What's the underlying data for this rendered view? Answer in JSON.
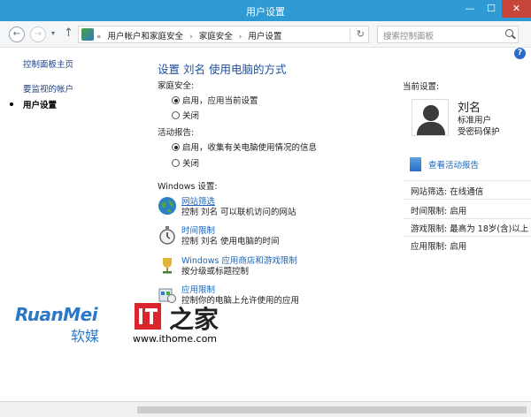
{
  "window": {
    "title": "用户设置",
    "min_symbol": "—",
    "max_symbol": "☐",
    "close_symbol": "✕"
  },
  "nav": {
    "back_symbol": "←",
    "forward_symbol": "→",
    "recent_symbol": "▾",
    "up_symbol": "↑",
    "breadcrumb_prefix": "«",
    "breadcrumbs": [
      "用户帐户和家庭安全",
      "家庭安全",
      "用户设置"
    ],
    "separator": "›",
    "dropdown_symbol": "▾",
    "refresh_symbol": "↻",
    "search_placeholder": "搜索控制面板"
  },
  "help_symbol": "?",
  "sidebar": {
    "home": "控制面板主页",
    "items": [
      "要监视的帐户",
      "用户设置"
    ]
  },
  "main": {
    "title": "设置 刘名 使用电脑的方式",
    "family_safety": {
      "label": "家庭安全:",
      "options": [
        "启用，应用当前设置",
        "关闭"
      ],
      "selected": 0
    },
    "activity": {
      "label": "活动报告:",
      "options": [
        "启用，收集有关电脑使用情况的信息",
        "关闭"
      ],
      "selected": 0
    },
    "windows_settings_label": "Windows 设置:",
    "settings": [
      {
        "name": "网站筛选",
        "desc": "控制 刘名 可以联机访问的网站",
        "icon": "globe-icon"
      },
      {
        "name": "时间限制",
        "desc": "控制 刘名 使用电脑的时间",
        "icon": "stopwatch-icon"
      },
      {
        "name": "Windows 应用商店和游戏限制",
        "desc": "按分级或标题控制",
        "icon": "trophy-icon"
      },
      {
        "name": "应用限制",
        "desc": "控制你的电脑上允许使用的应用",
        "icon": "app-restriction-icon"
      }
    ]
  },
  "panel": {
    "current_settings": "当前设置:",
    "user_name": "刘名",
    "user_type": "标准用户",
    "user_password": "受密码保护",
    "report_link": "查看活动报告",
    "details": [
      {
        "label": "网站筛选",
        "value": "在线通信"
      },
      {
        "label": "时间限制",
        "value": "启用"
      },
      {
        "label": "游戏限制",
        "value": "最高为 18岁(含)以上"
      },
      {
        "label": "应用限制",
        "value": "启用"
      }
    ]
  },
  "watermark": {
    "ruanmei": "RuanMei",
    "ruanmei_cn": "软媒",
    "it_letters": "IT",
    "zhi": "之家",
    "url": "www.ithome.com"
  },
  "colors": {
    "titlebar": "#2f9ad4",
    "link": "#1a65b8",
    "heading": "#1e4e9c",
    "watermark_blue": "#2a78c6",
    "it_red": "#d9252b"
  }
}
